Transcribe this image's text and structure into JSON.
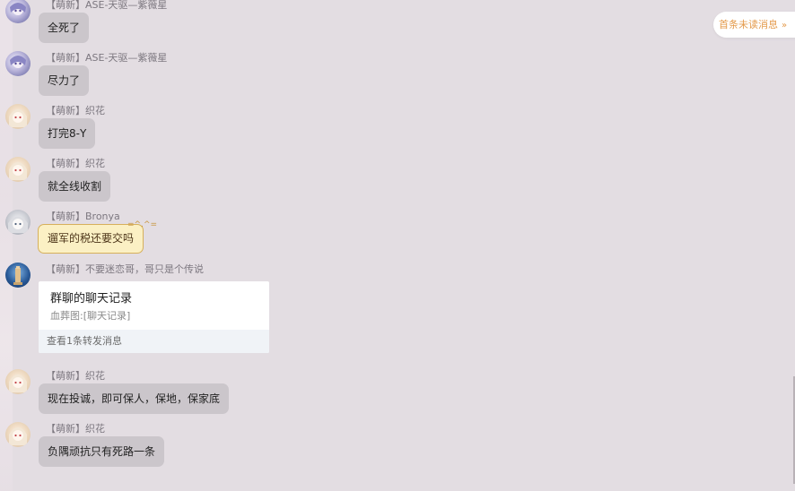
{
  "unread": {
    "label": "首条未读消息",
    "icon": "double-chevron-up-icon",
    "color": "#e49a4b"
  },
  "messages": [
    {
      "sender": "【萌新】ASE-天驱—紫薇星",
      "text": "全死了"
    },
    {
      "sender": "【萌新】ASE-天驱—紫薇星",
      "text": "尽力了"
    },
    {
      "sender": "【萌新】织花",
      "text": "打完8-Y"
    },
    {
      "sender": "【萌新】织花",
      "text": "就全线收割"
    },
    {
      "sender": "【萌新】Bronya",
      "text": "遛军的税还要交吗"
    },
    {
      "sender": "【萌新】不要迷恋哥，哥只是个传说",
      "forward": {
        "title": "群聊的聊天记录",
        "preview": "血葬图:[聊天记录]",
        "footer": "查看1条转发消息"
      }
    },
    {
      "sender": "【萌新】织花",
      "text": "现在投诚，即可保人，保地，保家底"
    },
    {
      "sender": "【萌新】织花",
      "text": "负隅顽抗只有死路一条"
    }
  ]
}
